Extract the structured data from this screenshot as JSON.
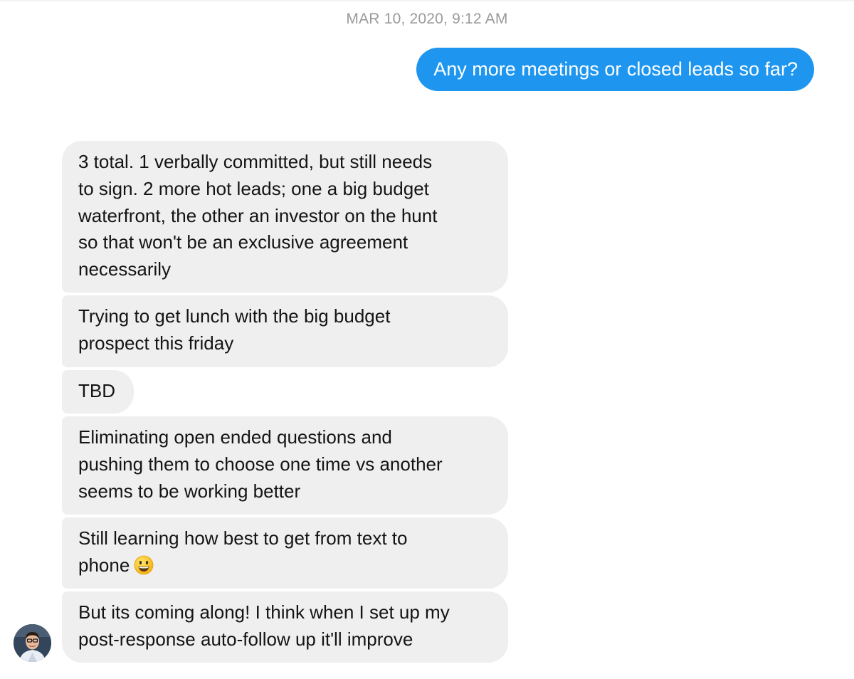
{
  "conversation": {
    "timestamp": "MAR 10, 2020, 9:12 AM",
    "outgoing_message": "Any more meetings or closed leads so far?",
    "incoming_messages": [
      "3 total. 1 verbally committed, but still needs\nto sign. 2 more hot leads; one a big budget\nwaterfront, the other an investor on the hunt\nso that won't be an exclusive agreement\nnecessarily",
      "Trying to get lunch with the big budget\nprospect this friday",
      "TBD",
      "Eliminating open ended questions and\npushing them to choose one time vs another\nseems to be working better",
      "Still learning how best to get from text to\nphone",
      "But its coming along! I think when I set up my\npost-response auto-follow up it'll improve"
    ],
    "emoji_icon": "grinning-face-emoji",
    "avatar_icon": "user-avatar-photo"
  },
  "colors": {
    "outgoing_bubble": "#1e96f0",
    "incoming_bubble": "#efefef",
    "timestamp_text": "#9a9a9a"
  }
}
